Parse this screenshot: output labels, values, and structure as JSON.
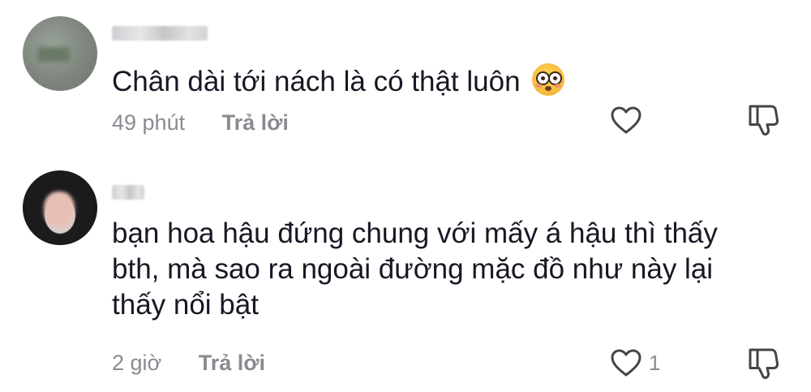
{
  "comments": [
    {
      "text": "Chân dài tới nách là có thật luôn",
      "emoji": "flushed-face",
      "time": "49 phút",
      "reply_label": "Trả lời",
      "likes": ""
    },
    {
      "text": "bạn hoa hậu đứng chung với mấy á hậu thì thấy bth, mà sao ra ngoài đường mặc đồ như này lại thấy nổi bật",
      "time": "2 giờ",
      "reply_label": "Trả lời",
      "likes": "1"
    }
  ],
  "icons": {
    "like": "heart-outline-icon",
    "dislike": "thumbs-down-icon"
  },
  "colors": {
    "text": "#161823",
    "meta": "#8a8b91",
    "background": "#ffffff"
  }
}
